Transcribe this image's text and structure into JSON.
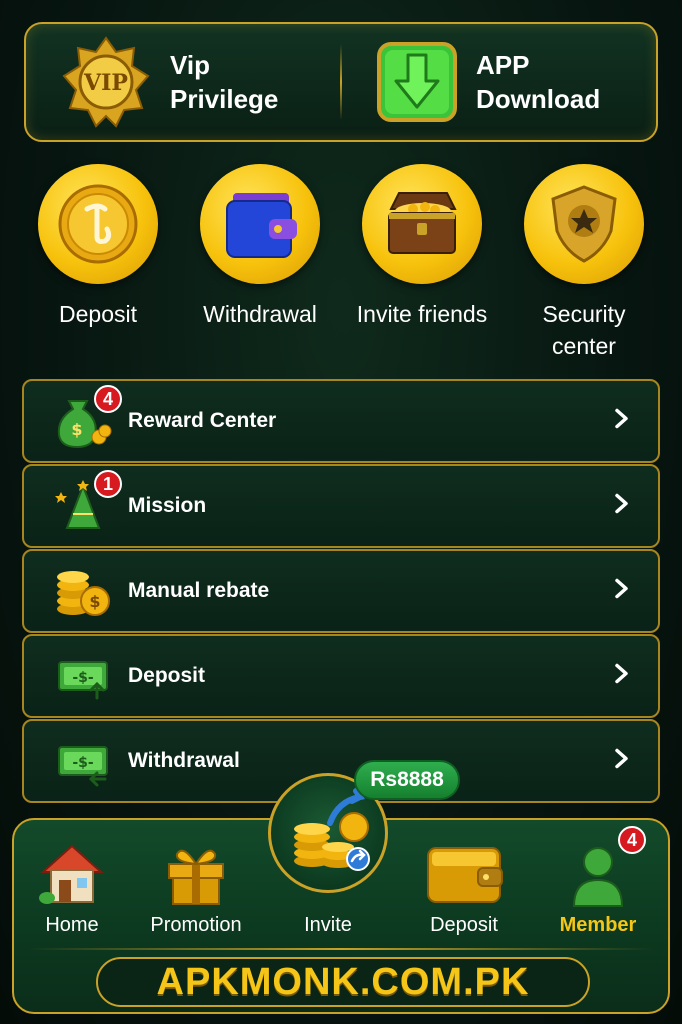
{
  "top_card": {
    "vip_label": "Vip\nPrivilege",
    "app_label": "APP\nDownload",
    "vip_badge_text": "VIP"
  },
  "quick_actions": [
    {
      "label": "Deposit",
      "icon": "coin-icon"
    },
    {
      "label": "Withdrawal",
      "icon": "wallet-icon"
    },
    {
      "label": "Invite friends",
      "icon": "treasure-chest-icon"
    },
    {
      "label": "Security\ncenter",
      "icon": "shield-icon"
    }
  ],
  "menu": [
    {
      "label": "Reward Center",
      "icon": "money-bag-icon",
      "badge": "4"
    },
    {
      "label": "Mission",
      "icon": "tree-icon",
      "badge": "1"
    },
    {
      "label": "Manual rebate",
      "icon": "coins-icon",
      "badge": ""
    },
    {
      "label": "Deposit",
      "icon": "cash-in-icon",
      "badge": ""
    },
    {
      "label": "Withdrawal",
      "icon": "cash-out-icon",
      "badge": ""
    }
  ],
  "nav": {
    "items": [
      {
        "label": "Home",
        "icon": "house-icon"
      },
      {
        "label": "Promotion",
        "icon": "gift-icon"
      },
      {
        "label": "Invite",
        "icon": "coins-share-icon"
      },
      {
        "label": "Deposit",
        "icon": "wallet-icon"
      },
      {
        "label": "Member",
        "icon": "user-icon",
        "badge": "4"
      }
    ],
    "invite_bonus": "Rs8888",
    "domain": "APKMONK.COM.PK"
  },
  "colors": {
    "gold": "#c9a227",
    "accent_yellow": "#f5c518",
    "badge_red": "#d71920",
    "green": "#2fae4e"
  }
}
